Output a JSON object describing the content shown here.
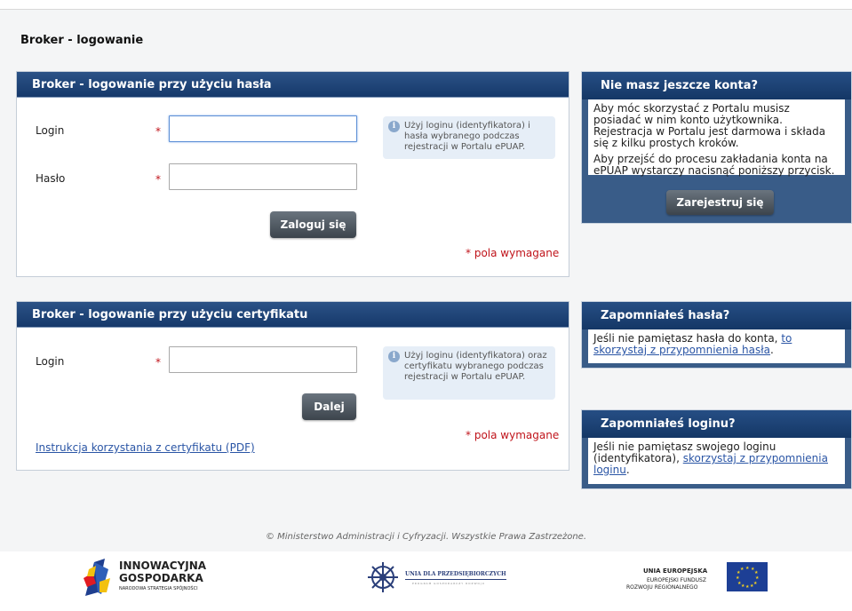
{
  "page": {
    "title": "Broker - logowanie"
  },
  "password_panel": {
    "header": "Broker - logowanie przy użyciu hasła",
    "login_label": "Login",
    "password_label": "Hasło",
    "required_star": "*",
    "login_value": "",
    "password_value": "",
    "tip": "Użyj loginu (identyfikatora) i hasła wybranego podczas rejestracji w Portalu ePUAP.",
    "submit_label": "Zaloguj się",
    "required_note_star": "*",
    "required_note": "pola wymagane"
  },
  "cert_panel": {
    "header": "Broker - logowanie przy użyciu certyfikatu",
    "login_label": "Login",
    "required_star": "*",
    "login_value": "",
    "tip": "Użyj loginu (identyfikatora) oraz certyfikatu wybranego podczas rejestracji w Portalu ePUAP.",
    "next_label": "Dalej",
    "instruction_link": "Instrukcja korzystania z certyfikatu (PDF)",
    "required_note_star": "*",
    "required_note": "pola wymagane"
  },
  "register_box": {
    "header": "Nie masz jeszcze konta?",
    "text1": "Aby móc skorzystać z Portalu musisz posiadać w nim konto użytkownika. Rejestracja w Portalu jest darmowa i składa się z kilku prostych kroków.",
    "text2": "Aby przejść do procesu zakładania konta na ePUAP wystarczy nacisnąć poniższy przycisk.",
    "button_label": "Zarejestruj się"
  },
  "forgot_password_box": {
    "header": "Zapomniałeś hasła?",
    "text": "Jeśli nie pamiętasz hasła do konta, ",
    "link": "to skorzystaj z przypomnienia hasła",
    "suffix": "."
  },
  "forgot_login_box": {
    "header": "Zapomniałeś loginu?",
    "text": "Jeśli nie pamiętasz swojego loginu (identyfikatora), ",
    "link": "skorzystaj z przypomnienia loginu",
    "suffix": "."
  },
  "footer": {
    "copyright": "© Ministerstwo Administracji i Cyfryzacji. Wszystkie Prawa Zastrzeżone.",
    "logo1_line1": "INNOWACYJNA",
    "logo1_line2": "GOSPODARKA",
    "logo1_line3": "NARODOWA STRATEGIA SPÓJNOŚCI",
    "logo2_line1": "UNIA DLA PRZEDSIĘBIORCZYCH",
    "logo2_line2": "PROGRAM GOSPODARCZY ROZWOJU",
    "logo3_line1": "UNIA EUROPEJSKA",
    "logo3_line2": "EUROPEJSKI FUNDUSZ",
    "logo3_line3": "ROZWOJU REGIONALNEGO"
  },
  "colors": {
    "header_dark": "#16396b",
    "required_red": "#c0141b",
    "link_blue": "#2a55a5",
    "tip_bg": "#e6eef7",
    "button_dark": "#3c444c"
  }
}
